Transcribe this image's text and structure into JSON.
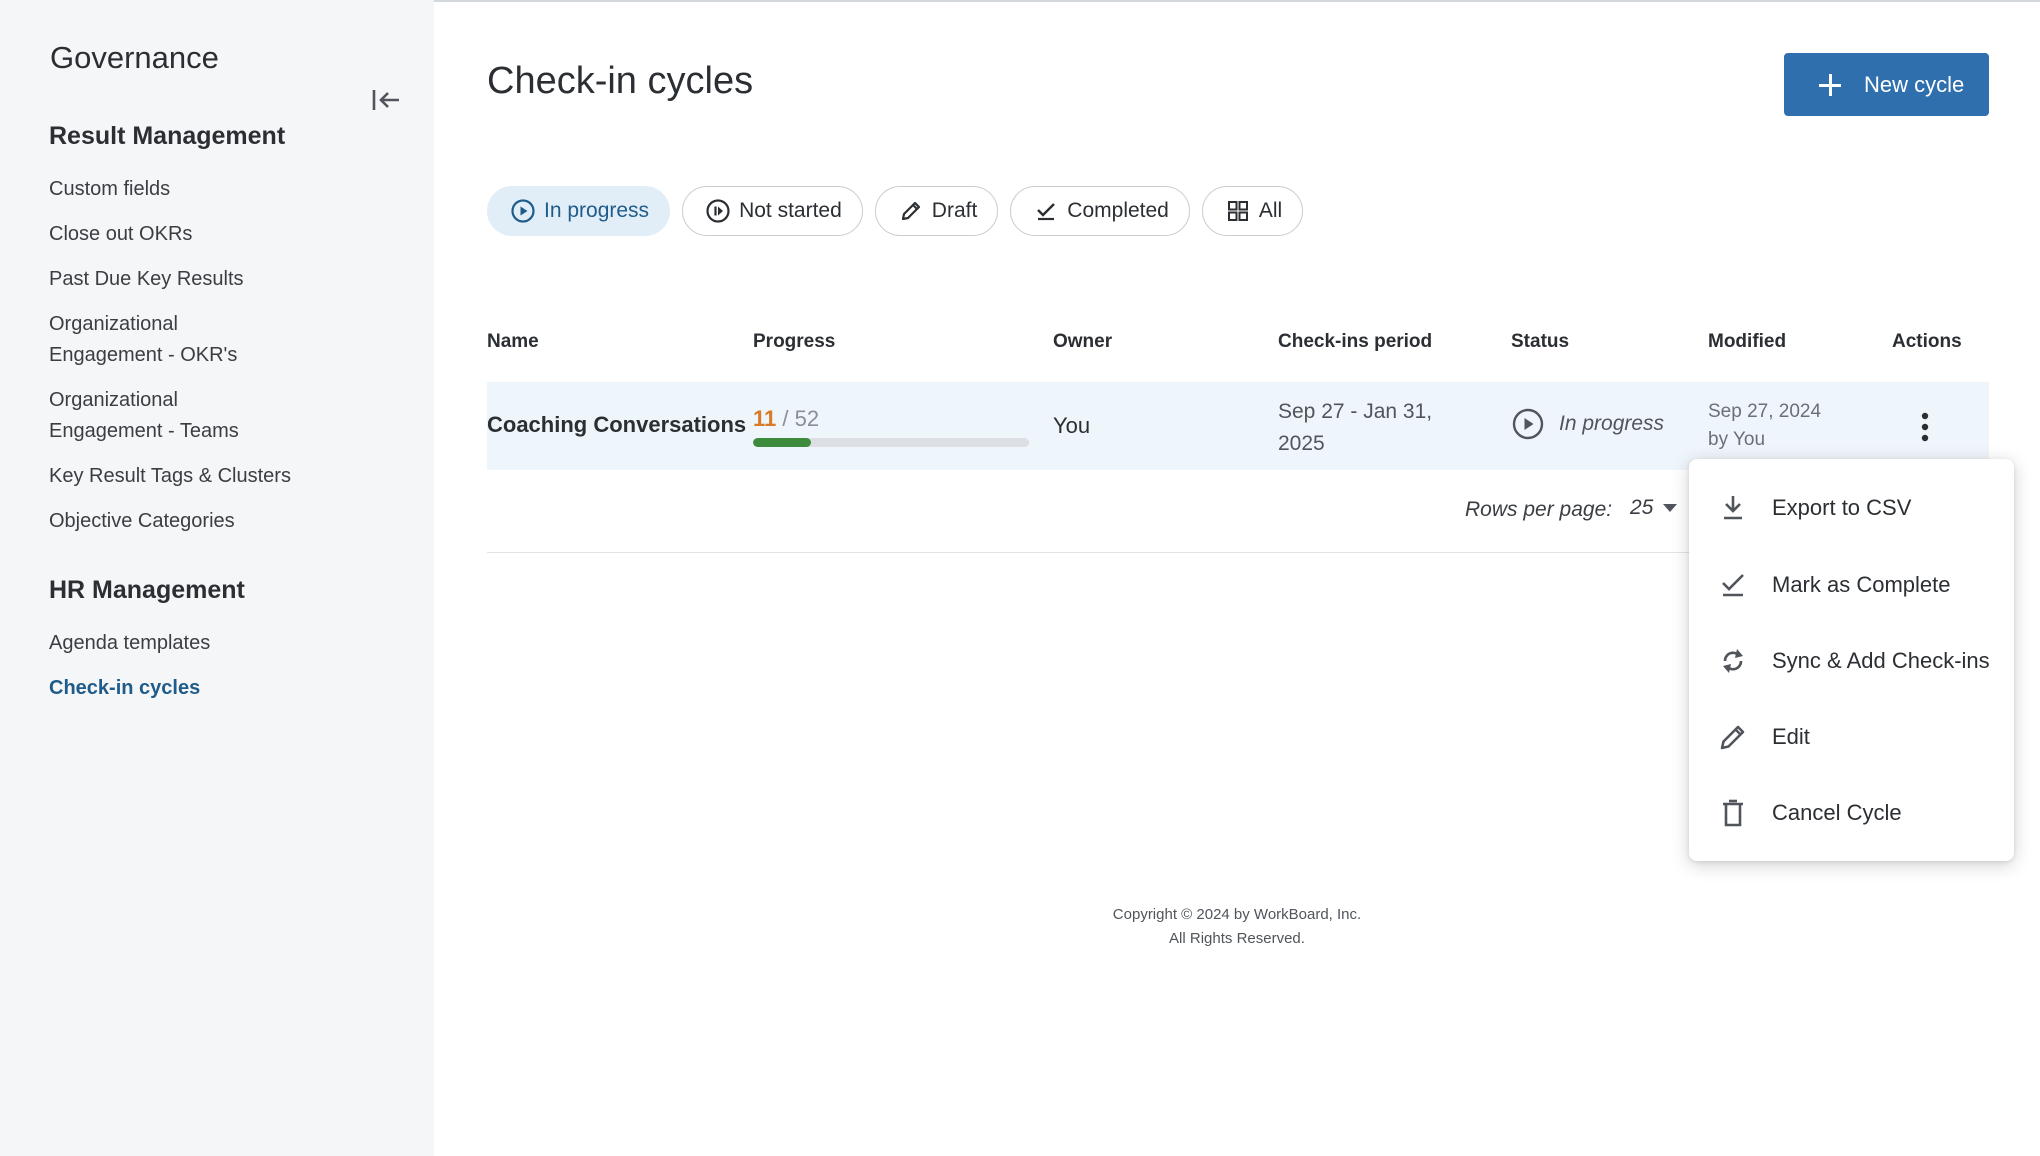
{
  "sidebar": {
    "title": "Governance",
    "sections": [
      {
        "heading": "Result Management",
        "items": [
          {
            "line1": "Custom fields",
            "line2": ""
          },
          {
            "line1": "Close out OKRs",
            "line2": ""
          },
          {
            "line1": "Past Due Key Results",
            "line2": ""
          },
          {
            "line1": "Organizational",
            "line2": "Engagement - OKR's"
          },
          {
            "line1": "Organizational",
            "line2": "Engagement - Teams"
          },
          {
            "line1": "Key Result Tags & Clusters",
            "line2": ""
          },
          {
            "line1": "Objective Categories",
            "line2": ""
          }
        ]
      },
      {
        "heading": "HR Management",
        "items": [
          {
            "line1": "Agenda templates",
            "line2": ""
          },
          {
            "line1": "Check-in cycles",
            "line2": ""
          }
        ]
      }
    ],
    "active_item": "Check-in cycles"
  },
  "header": {
    "title": "Check-in cycles",
    "new_button_label": "New cycle"
  },
  "filters": [
    {
      "label": "In progress",
      "icon": "play-circle-icon",
      "active": true
    },
    {
      "label": "Not started",
      "icon": "pause-circle-icon",
      "active": false
    },
    {
      "label": "Draft",
      "icon": "pencil-icon",
      "active": false
    },
    {
      "label": "Completed",
      "icon": "check-icon",
      "active": false
    },
    {
      "label": "All",
      "icon": "grid-icon",
      "active": false
    }
  ],
  "table": {
    "columns": [
      "Name",
      "Progress",
      "Owner",
      "Check-ins period",
      "Status",
      "Modified",
      "Actions"
    ],
    "rows": [
      {
        "name": "Coaching Conversations",
        "progress_done": "11",
        "progress_total": "/ 52",
        "progress_fraction": 0.2115,
        "owner": "You",
        "period_line1": "Sep 27 - Jan 31,",
        "period_line2": "2025",
        "status": "In progress",
        "modified_date": "Sep 27, 2024",
        "modified_by": "by You"
      }
    ],
    "rows_per_page_label": "Rows per page:",
    "rows_per_page_value": "25"
  },
  "context_menu": {
    "items": [
      {
        "label": "Export to CSV",
        "icon": "download-icon"
      },
      {
        "label": "Mark as Complete",
        "icon": "check-icon"
      },
      {
        "label": "Sync & Add Check-ins",
        "icon": "sync-icon"
      },
      {
        "label": "Edit",
        "icon": "pencil-icon"
      },
      {
        "label": "Cancel Cycle",
        "icon": "trash-icon"
      }
    ]
  },
  "footer": {
    "line1": "Copyright © 2024 by WorkBoard, Inc.",
    "line2": "All Rights Reserved."
  },
  "colors": {
    "accent": "#2f6fad",
    "active_nav": "#1f5c8a",
    "active_chip_bg": "#e1eef8",
    "progress_fill": "#3d8c3e",
    "progress_done_text": "#d97a26"
  }
}
